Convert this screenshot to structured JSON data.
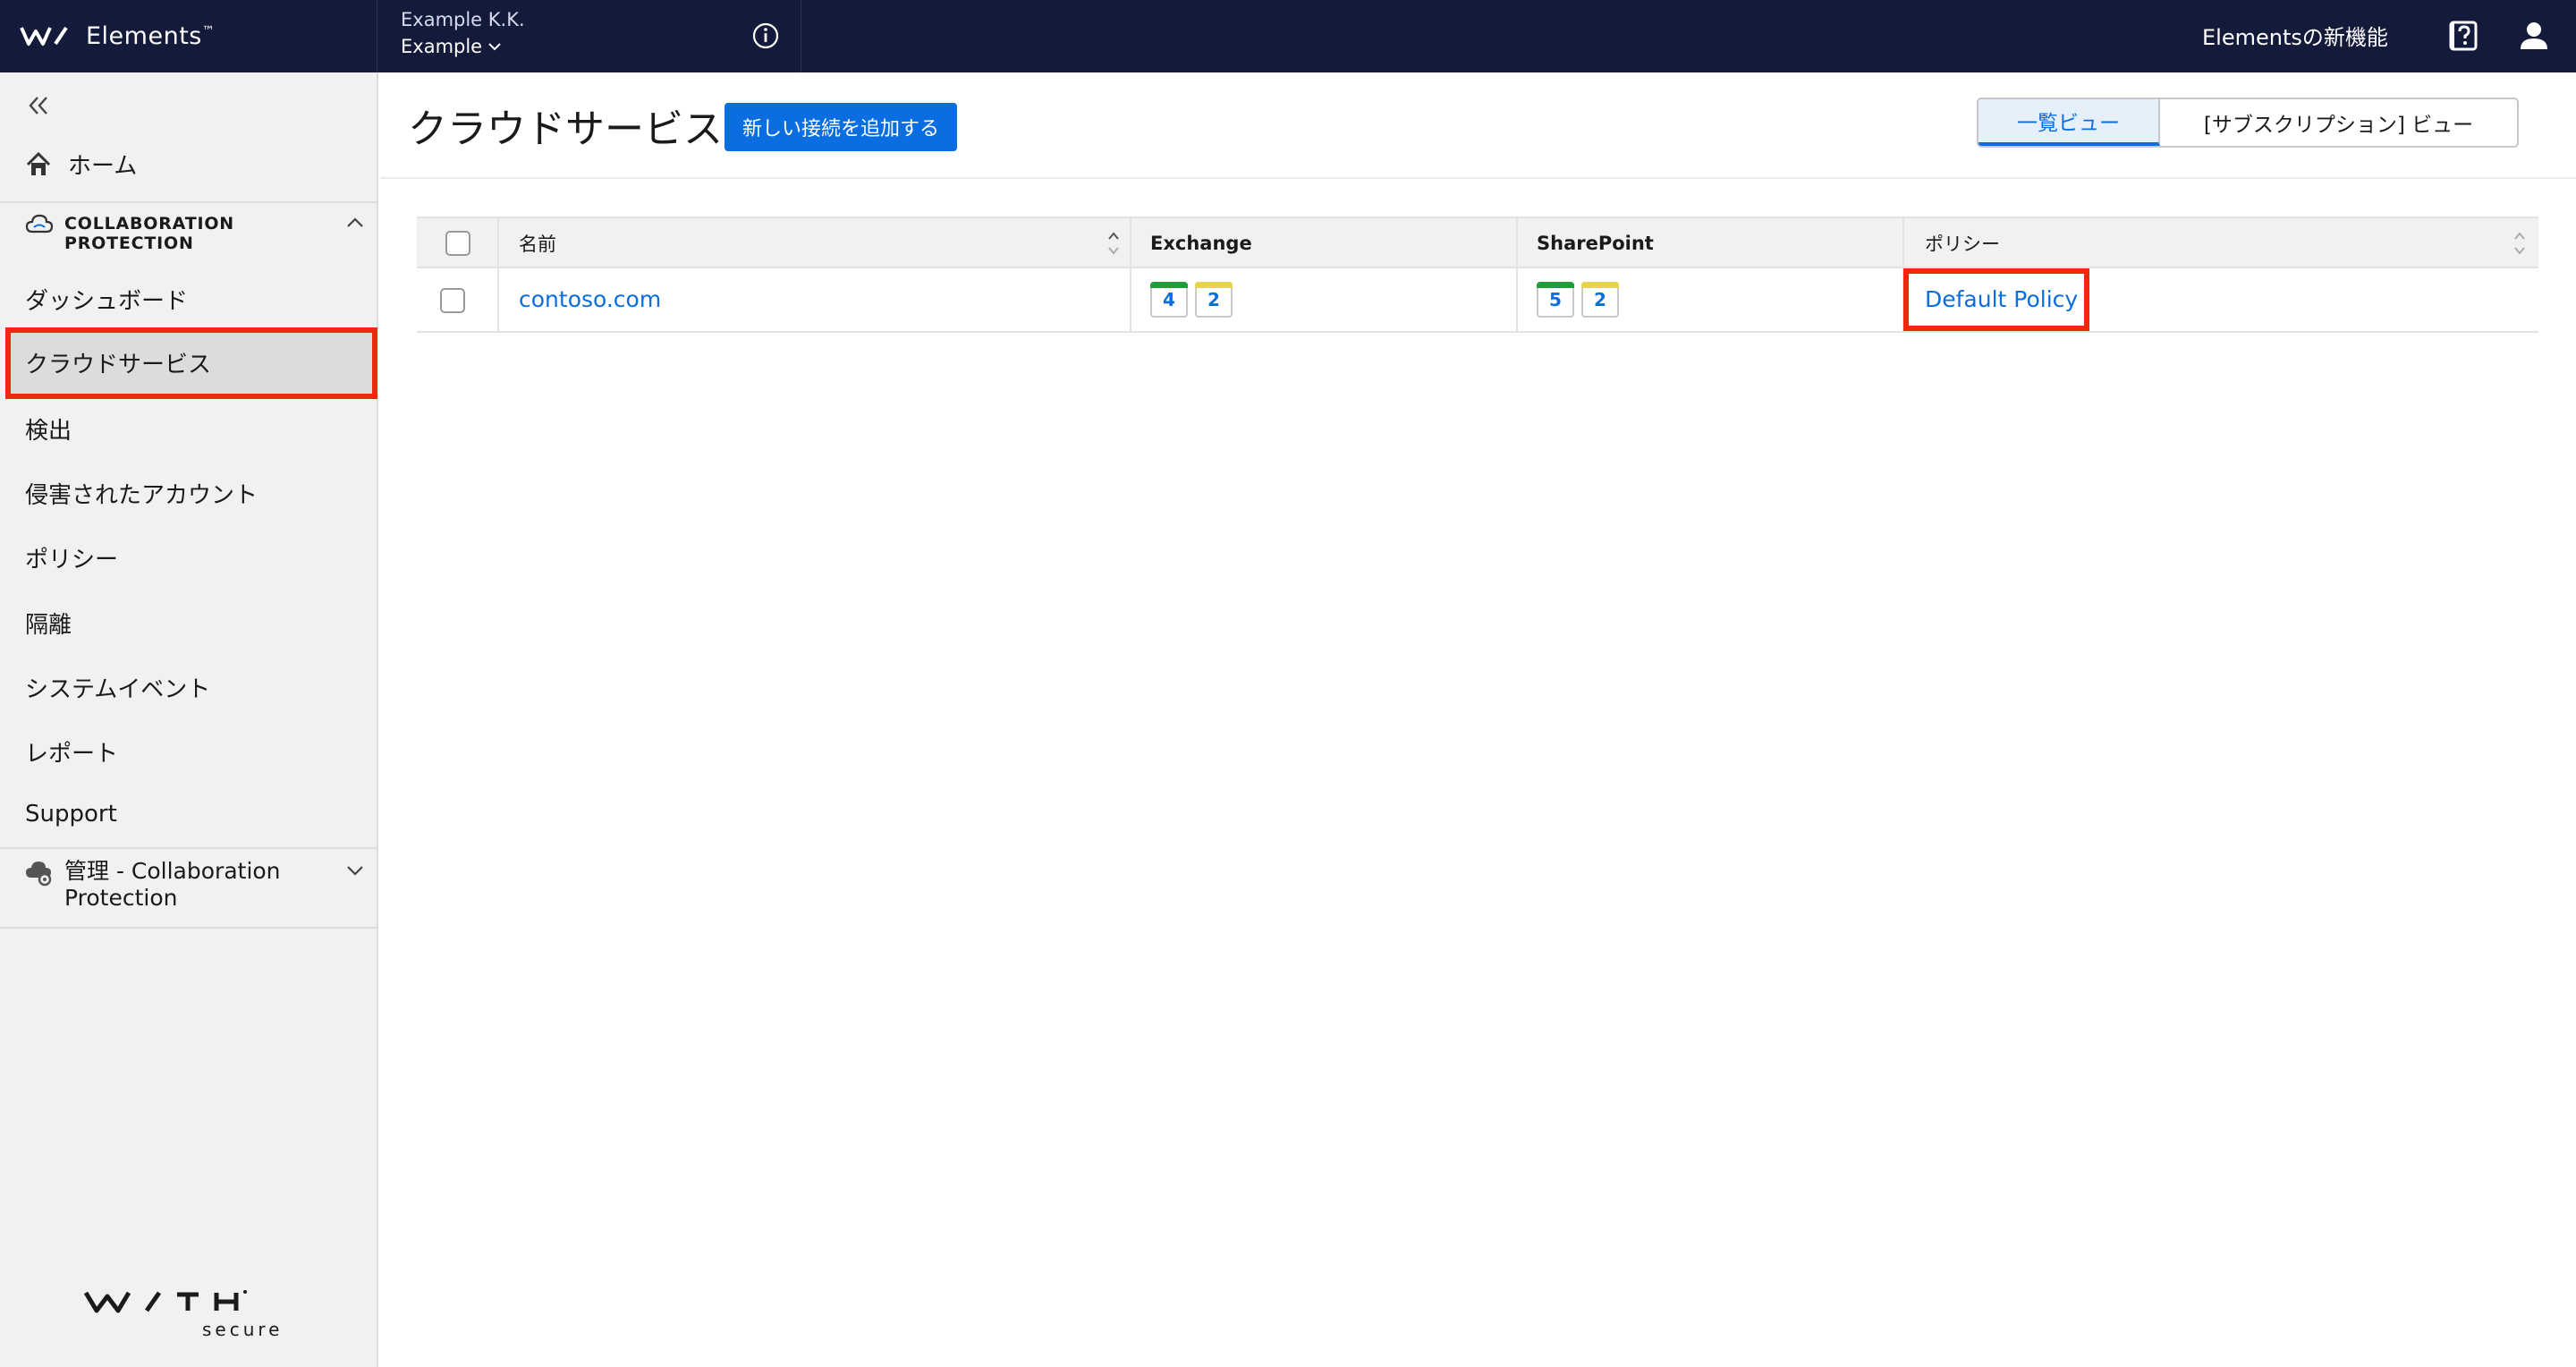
{
  "app": {
    "brand_name": "Elements",
    "brand_tm": "™",
    "org_name": "Example K.K.",
    "org_sub": "Example",
    "whats_new": "Elementsの新機能"
  },
  "sidebar": {
    "home": "ホーム",
    "section_title": "COLLABORATION PROTECTION",
    "items": [
      {
        "label": "ダッシュボード"
      },
      {
        "label": "クラウドサービス"
      },
      {
        "label": "検出"
      },
      {
        "label": "侵害されたアカウント"
      },
      {
        "label": "ポリシー"
      },
      {
        "label": "隔離"
      },
      {
        "label": "システムイベント"
      },
      {
        "label": "レポート"
      },
      {
        "label": "Support"
      }
    ],
    "admin_label": "管理 - Collaboration Protection",
    "footer_logo_text": "WITH secure"
  },
  "main": {
    "title": "クラウドサービス",
    "add_button": "新しい接続を追加する",
    "view_list": "一覧ビュー",
    "view_subscription": "[サブスクリプション] ビュー",
    "columns": [
      "名前",
      "Exchange",
      "SharePoint",
      "ポリシー"
    ],
    "rows": [
      {
        "name": "contoso.com",
        "exchange": {
          "green": "4",
          "yellow": "2"
        },
        "sharepoint": {
          "green": "5",
          "yellow": "2"
        },
        "policy": "Default Policy"
      }
    ]
  },
  "colors": {
    "topbar": "#131a3a",
    "accent": "#0b6ee0",
    "highlight": "#f02810",
    "badge_green": "#1f9d3a",
    "badge_yellow": "#e9d54a"
  }
}
